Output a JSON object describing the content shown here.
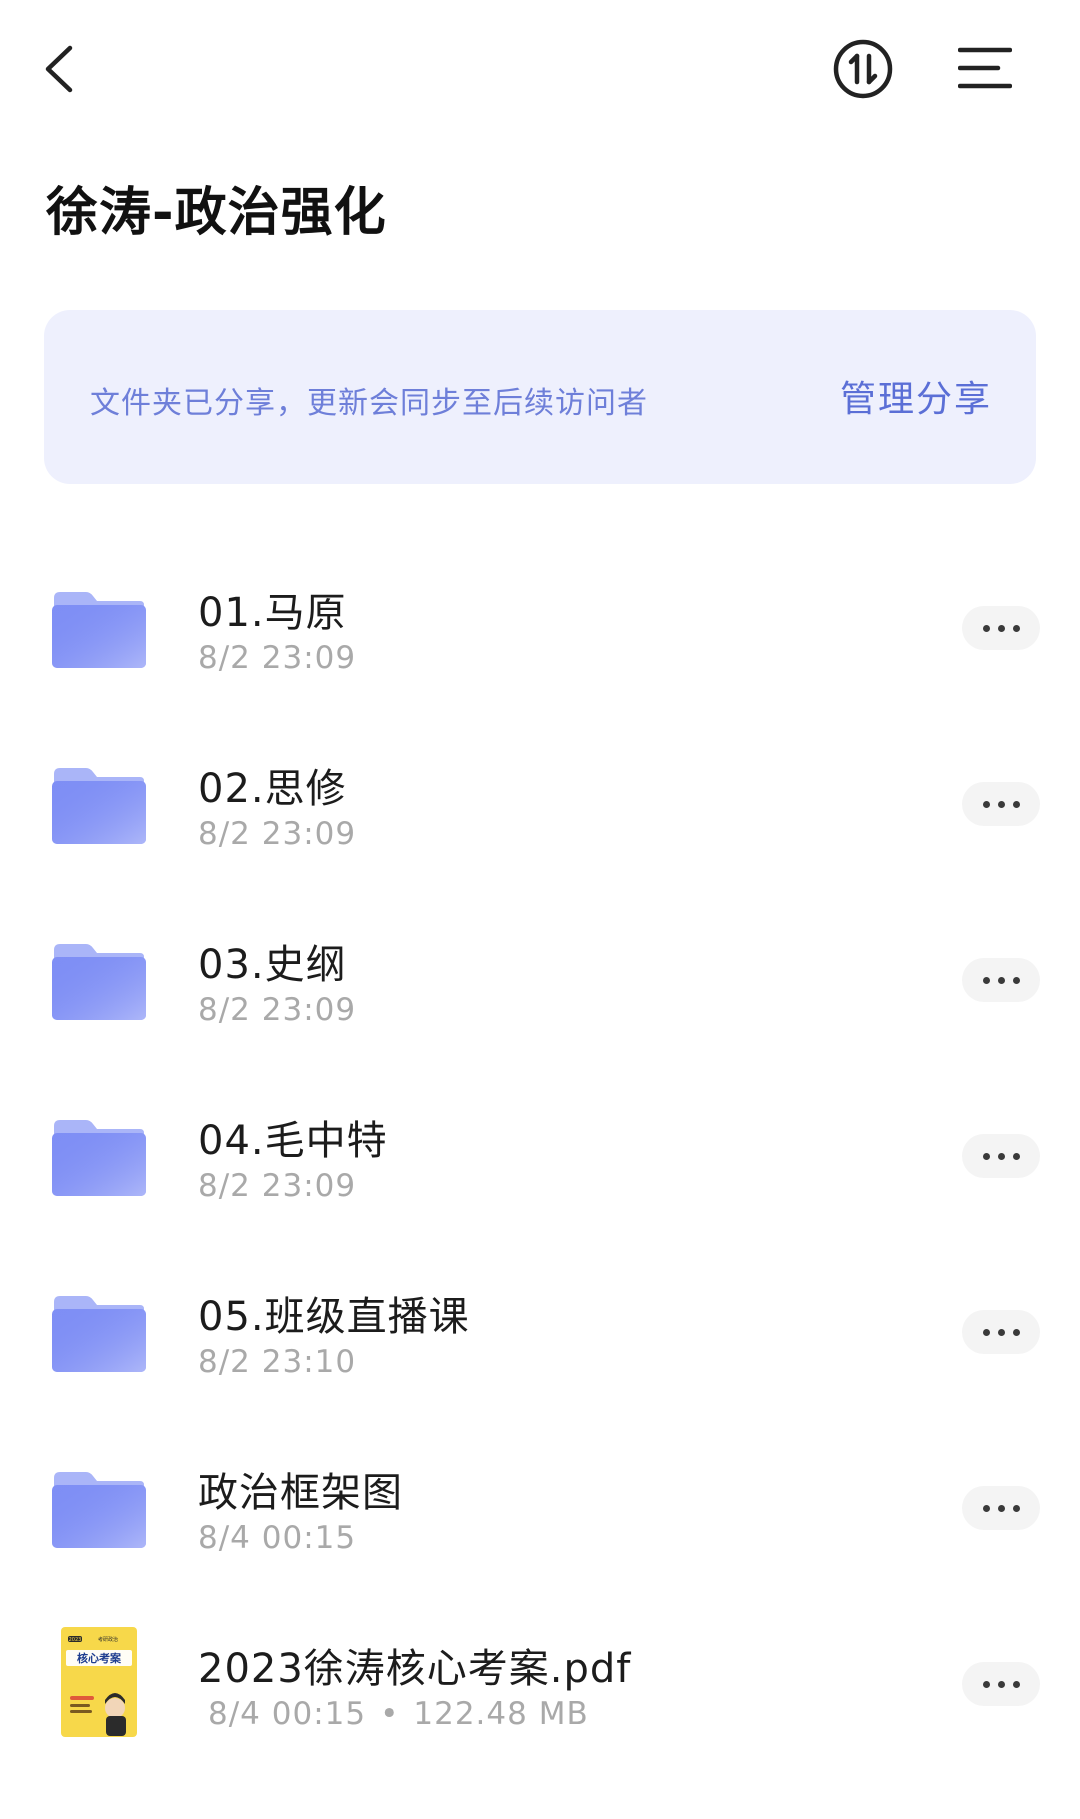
{
  "header": {
    "title": "徐涛-政治强化",
    "back_icon": "chevron-left-icon",
    "transfer_icon": "transfer-updown-icon",
    "menu_icon": "menu-lines-icon"
  },
  "share_banner": {
    "text": "文件夹已分享，更新会同步至后续访问者",
    "manage_label": "管理分享"
  },
  "files": [
    {
      "name": "01.马原",
      "time": "8/2 23:09",
      "type": "folder"
    },
    {
      "name": "02.思修",
      "time": "8/2 23:09",
      "type": "folder"
    },
    {
      "name": "03.史纲",
      "time": "8/2 23:09",
      "type": "folder"
    },
    {
      "name": "04.毛中特",
      "time": "8/2 23:09",
      "type": "folder"
    },
    {
      "name": "05.班级直播课",
      "time": "8/2 23:10",
      "type": "folder"
    },
    {
      "name": "政治框架图",
      "time": "8/4 00:15",
      "type": "folder"
    },
    {
      "name": "2023徐涛核心考案.pdf",
      "time": "8/4 00:15",
      "separator": "•",
      "size": "122.48 MB",
      "type": "pdf",
      "thumbnail": {
        "line1_badge": "2023",
        "line1_text": "考研政治",
        "title": "核心考案"
      }
    }
  ],
  "colors": {
    "banner_bg": "#eef0fd",
    "banner_text": "#6e7fd9",
    "manage_text": "#5b6fd6",
    "folder_main": "#7f8ff5",
    "folder_tab": "#aab5f8",
    "meta_text": "#a9a9a9",
    "pdf_cover": "#f7d84a"
  }
}
